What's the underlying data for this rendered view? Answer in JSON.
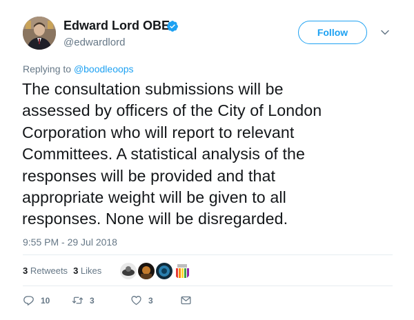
{
  "user": {
    "display_name": "Edward Lord OBE",
    "screen_name": "@edwardlord",
    "verified": true
  },
  "follow_label": "Follow",
  "reply_context": {
    "prefix": "Replying to ",
    "mention": "@boodleoops"
  },
  "tweet": {
    "text": "The consultation submissions will be\nassessed by officers of the City of London\nCorporation who will report to relevant\nCommittees. A statistical analysis of the\nresponses will be provided and that\nappropriate weight will be given to all\nresponses. None will be disregarded.",
    "timestamp": "9:55 PM - 29 Jul 2018"
  },
  "stats": {
    "retweets_count": "3",
    "retweets_label": "Retweets",
    "likes_count": "3",
    "likes_label": "Likes"
  },
  "actions": {
    "reply_count": "10",
    "retweet_count": "3",
    "like_count": "3"
  },
  "colors": {
    "accent": "#1da1f2",
    "muted": "#657786",
    "text": "#14171a",
    "divider": "#e6ecf0"
  },
  "icons": [
    "verified-icon",
    "caret-down-icon",
    "reply-icon",
    "retweet-icon",
    "heart-icon",
    "direct-message-icon"
  ]
}
